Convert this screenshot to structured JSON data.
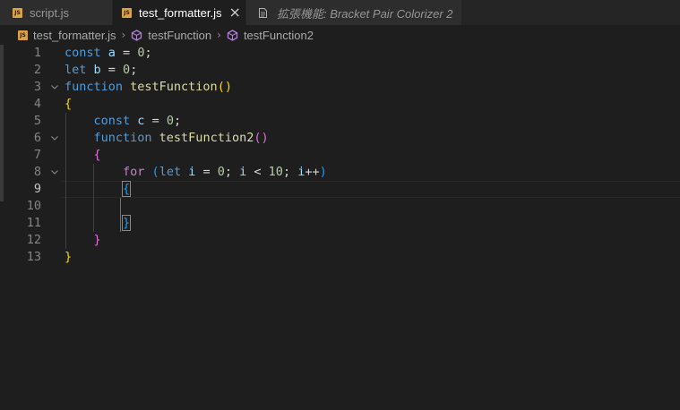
{
  "tabs": [
    {
      "label": "script.js",
      "icon": "js-file-icon",
      "icon_text": "JS"
    },
    {
      "label": "test_formatter.js",
      "icon": "js-file-icon",
      "icon_text": "JS",
      "active": true,
      "close": "×"
    },
    {
      "label": "拡張機能: Bracket Pair Colorizer 2",
      "icon": "extension-doc-icon",
      "preview": true
    }
  ],
  "breadcrumb": {
    "file": "test_formatter.js",
    "file_icon_text": "JS",
    "symbols": [
      "testFunction",
      "testFunction2"
    ],
    "separator": "›"
  },
  "editor": {
    "line_numbers": [
      "1",
      "2",
      "3",
      "4",
      "5",
      "6",
      "7",
      "8",
      "9",
      "10",
      "11",
      "12",
      "13"
    ],
    "current_line": 9,
    "lines": [
      [
        {
          "t": "const ",
          "c": "kw"
        },
        {
          "t": "a",
          "c": "var"
        },
        {
          "t": " = ",
          "c": "op"
        },
        {
          "t": "0",
          "c": "num"
        },
        {
          "t": ";",
          "c": "op"
        }
      ],
      [
        {
          "t": "let ",
          "c": "kw"
        },
        {
          "t": "b",
          "c": "var"
        },
        {
          "t": " = ",
          "c": "op"
        },
        {
          "t": "0",
          "c": "num"
        },
        {
          "t": ";",
          "c": "op"
        }
      ],
      [
        {
          "t": "function ",
          "c": "kw"
        },
        {
          "t": "testFunction",
          "c": "fn"
        },
        {
          "t": "()",
          "c": "b1"
        }
      ],
      [
        {
          "t": "{",
          "c": "b1"
        }
      ],
      [
        {
          "t": "    "
        },
        {
          "t": "const ",
          "c": "kw"
        },
        {
          "t": "c",
          "c": "var"
        },
        {
          "t": " = ",
          "c": "op"
        },
        {
          "t": "0",
          "c": "num"
        },
        {
          "t": ";",
          "c": "op"
        }
      ],
      [
        {
          "t": "    "
        },
        {
          "t": "function ",
          "c": "kw"
        },
        {
          "t": "testFunction2",
          "c": "fn"
        },
        {
          "t": "()",
          "c": "b2"
        }
      ],
      [
        {
          "t": "    "
        },
        {
          "t": "{",
          "c": "b2"
        }
      ],
      [
        {
          "t": "        "
        },
        {
          "t": "for ",
          "c": "ctl"
        },
        {
          "t": "(",
          "c": "b3"
        },
        {
          "t": "let ",
          "c": "kw"
        },
        {
          "t": "i",
          "c": "var"
        },
        {
          "t": " = ",
          "c": "op"
        },
        {
          "t": "0",
          "c": "num"
        },
        {
          "t": "; ",
          "c": "op"
        },
        {
          "t": "i",
          "c": "var"
        },
        {
          "t": " < ",
          "c": "op"
        },
        {
          "t": "10",
          "c": "num"
        },
        {
          "t": "; ",
          "c": "op"
        },
        {
          "t": "i",
          "c": "var"
        },
        {
          "t": "++",
          "c": "op"
        },
        {
          "t": ")",
          "c": "b3"
        }
      ],
      [
        {
          "t": "        "
        },
        {
          "t": "{",
          "c": "b3 b3box"
        }
      ],
      [],
      [
        {
          "t": "        "
        },
        {
          "t": "}",
          "c": "b3 b3box"
        }
      ],
      [
        {
          "t": "    "
        },
        {
          "t": "}",
          "c": "b2"
        }
      ],
      [
        {
          "t": "}",
          "c": "b1"
        }
      ]
    ],
    "fold_lines": [
      3,
      6,
      8
    ]
  },
  "colors": {
    "background": "#1e1e1e",
    "tabbar": "#252526",
    "keyword": "#569cd6",
    "control": "#c586c0",
    "variable": "#9cdcfe",
    "function": "#dcdcaa",
    "number": "#b5cea8",
    "bracket_level1": "#ffd700",
    "bracket_level2": "#da70d6",
    "bracket_level3": "#179fff",
    "js_icon": "#d7a24a"
  }
}
